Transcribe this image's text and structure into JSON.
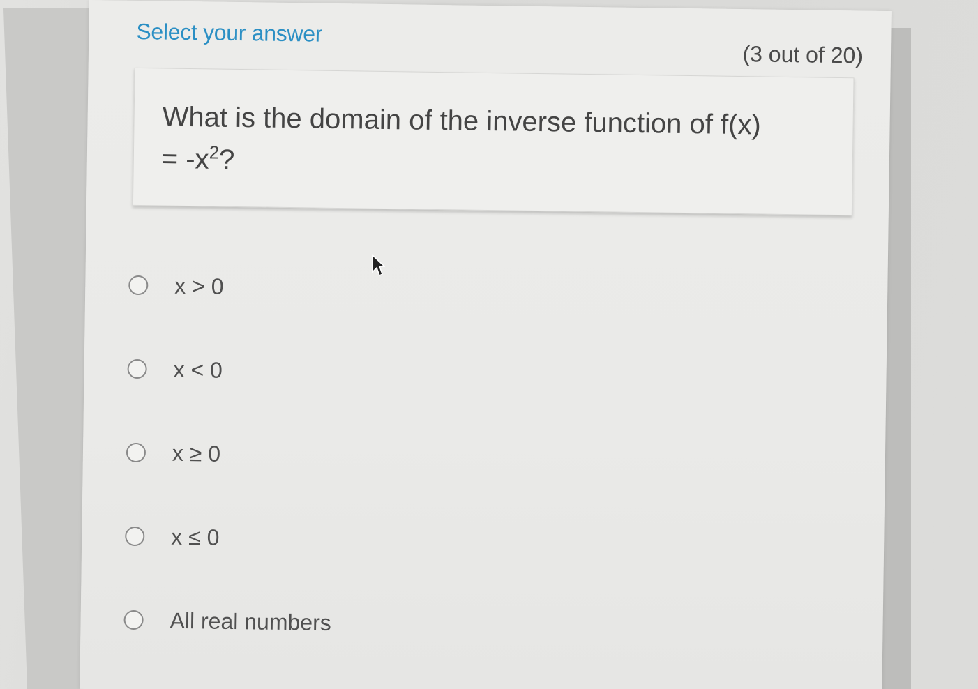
{
  "header": {
    "title": "Select your answer",
    "progress": "(3 out of 20)"
  },
  "question": {
    "text_main": "What is the domain of the inverse function of  f(x)",
    "text_line2_prefix": "= -x",
    "text_sup": "2",
    "text_suffix": "?"
  },
  "options": [
    {
      "label": "x > 0",
      "selected": false
    },
    {
      "label": "x < 0",
      "selected": false
    },
    {
      "label": "x ≥ 0",
      "selected": false
    },
    {
      "label": "x ≤ 0",
      "selected": false
    },
    {
      "label": "All real numbers",
      "selected": false
    }
  ],
  "colors": {
    "accent": "#2b8fc4",
    "text": "#444444"
  }
}
